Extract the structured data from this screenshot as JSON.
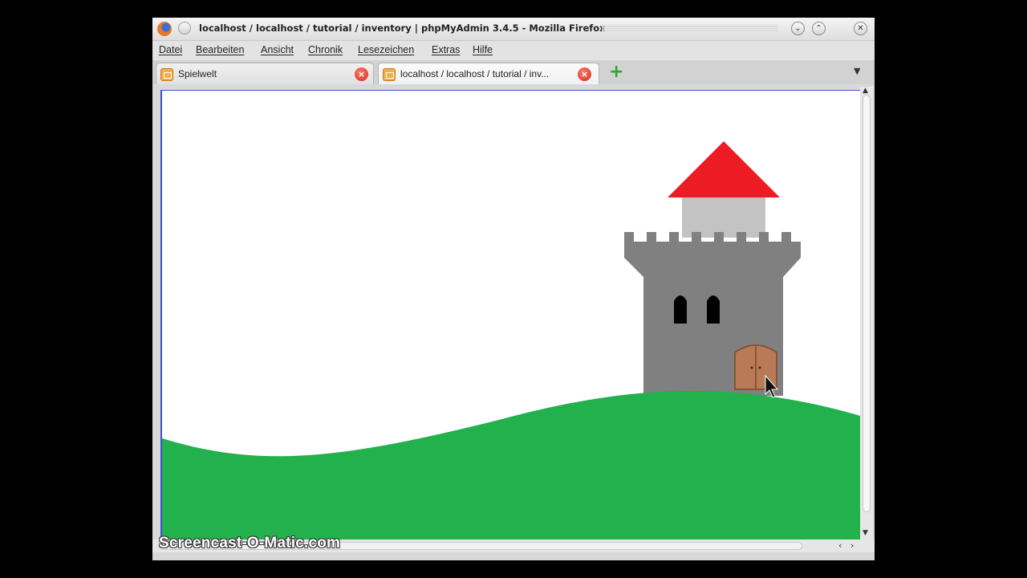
{
  "window": {
    "title": "localhost / localhost / tutorial / inventory | phpMyAdmin 3.4.5 - Mozilla Firefox"
  },
  "menu": {
    "items": [
      "Datei",
      "Bearbeiten",
      "Ansicht",
      "Chronik",
      "Lesezeichen",
      "Extras",
      "Hilfe"
    ]
  },
  "tabs": [
    {
      "label": "Spielwelt",
      "active": false
    },
    {
      "label": "localhost / localhost / tutorial / inv...",
      "active": true
    }
  ],
  "icons": {
    "app": "firefox-icon",
    "tab_close": "close-icon",
    "new_tab": "plus-icon",
    "tab_list": "chevron-down-icon",
    "cursor": "mouse-pointer-icon"
  },
  "scene": {
    "grass_color": "#22b14c",
    "roof_color": "#ed1c24",
    "tower_color": "#808080",
    "top_color": "#c3c3c3",
    "door_color": "#b97a57",
    "window_color": "#000000"
  },
  "watermark": "Screencast-O-Matic.com"
}
